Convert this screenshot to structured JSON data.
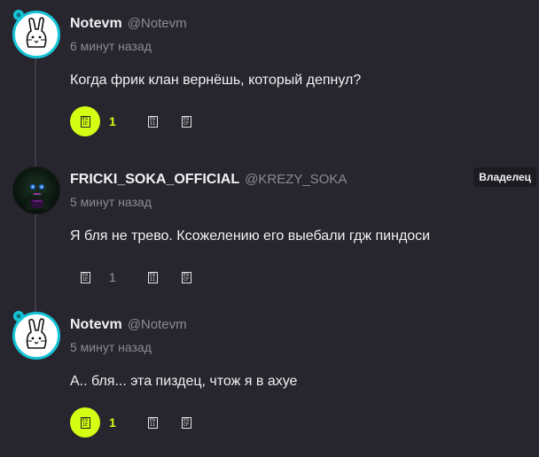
{
  "comments": [
    {
      "author": "Notevm",
      "handle": "@Notevm",
      "time": "6 минут назад",
      "text": "Когда фрик клан вернёшь, который депнул?",
      "likes": "1",
      "liked": true,
      "avatar": "white-bunny-avatar"
    },
    {
      "author": "FRICKI_SOKA_OFFICIAL",
      "handle": "@KREZY_SOKA",
      "time": "5 минут назад",
      "text": "Я бля не трево. Ксожелению его выебали гдж пиндоси",
      "likes": "1",
      "liked": false,
      "badge": "Владелец",
      "avatar": "dark-green-figure-avatar"
    },
    {
      "author": "Notevm",
      "handle": "@Notevm",
      "time": "5 минут назад",
      "text": "А.. бля... эта пиздец, чтож я в ахуе",
      "likes": "1",
      "liked": true,
      "avatar": "white-bunny-avatar"
    }
  ],
  "icons": {
    "like": "like-icon",
    "reply": "reply-icon",
    "share": "share-icon"
  },
  "glyphs": {
    "like": "E9 1E",
    "reply": "E9 11",
    "share": "E9 CF"
  },
  "colors": {
    "background": "#27252d",
    "accent": "#d4ff14",
    "avatar_ring": "#17c4d8",
    "muted": "#8c8a93"
  }
}
